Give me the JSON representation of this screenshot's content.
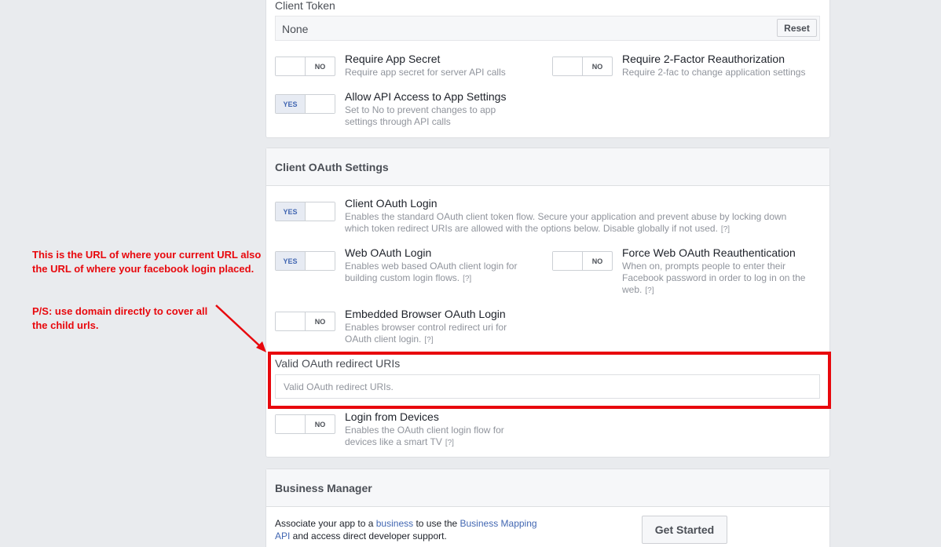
{
  "client_token": {
    "label": "Client Token",
    "value": "None",
    "reset_label": "Reset"
  },
  "security": {
    "require_app_secret": {
      "title": "Require App Secret",
      "desc": "Require app secret for server API calls",
      "state": "NO"
    },
    "require_2fa": {
      "title": "Require 2-Factor Reauthorization",
      "desc": "Require 2-fac to change application settings",
      "state": "NO"
    },
    "allow_api_access": {
      "title": "Allow API Access to App Settings",
      "desc": "Set to No to prevent changes to app settings through API calls",
      "state": "YES"
    }
  },
  "oauth": {
    "heading": "Client OAuth Settings",
    "client_oauth_login": {
      "title": "Client OAuth Login",
      "desc": "Enables the standard OAuth client token flow. Secure your application and prevent abuse by locking down which token redirect URIs are allowed with the options below. Disable globally if not used.",
      "state": "YES"
    },
    "web_oauth_login": {
      "title": "Web OAuth Login",
      "desc": "Enables web based OAuth client login for building custom login flows.",
      "state": "YES"
    },
    "force_web_reauth": {
      "title": "Force Web OAuth Reauthentication",
      "desc": "When on, prompts people to enter their Facebook password in order to log in on the web.",
      "state": "NO"
    },
    "embedded_browser": {
      "title": "Embedded Browser OAuth Login",
      "desc": "Enables browser control redirect uri for OAuth client login.",
      "state": "NO"
    },
    "redirect_uris": {
      "label": "Valid OAuth redirect URIs",
      "placeholder": "Valid OAuth redirect URIs."
    },
    "login_from_devices": {
      "title": "Login from Devices",
      "desc": "Enables the OAuth client login flow for devices like a smart TV",
      "state": "NO"
    },
    "help": "[?]"
  },
  "business": {
    "heading": "Business Manager",
    "text_1": "Associate your app to a ",
    "link_1": "business",
    "text_2": " to use the ",
    "link_2": "Business Mapping API",
    "text_3": " and access direct developer support.",
    "button": "Get Started"
  },
  "annotation": {
    "line1": "This is the URL of where your current URL also the URL of where your facebook login placed.",
    "line2": "P/S: use domain directly to cover all the child urls."
  },
  "colors": {
    "accent": "#4267b2",
    "annotation": "#e8080d"
  }
}
